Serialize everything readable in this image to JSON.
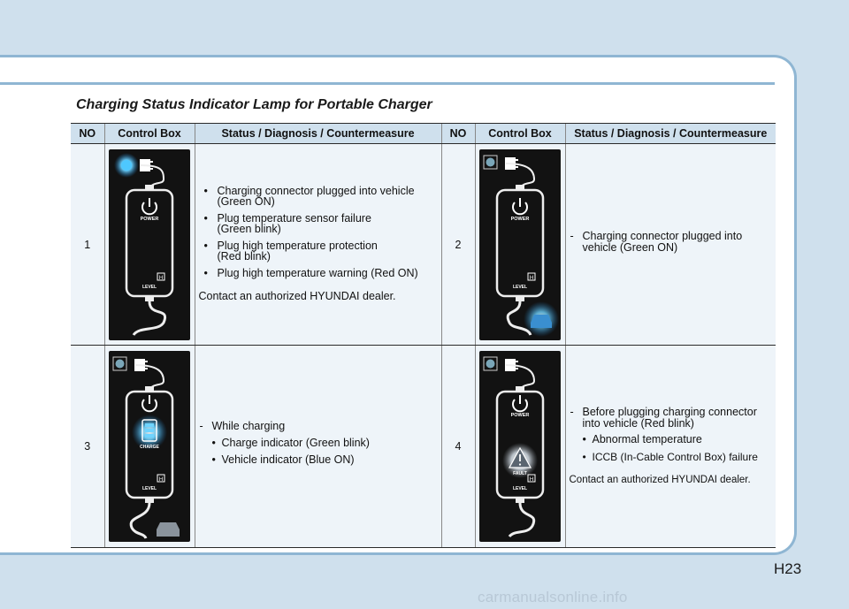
{
  "title": "Charging Status Indicator Lamp for Portable Charger",
  "table": {
    "headers": [
      "NO",
      "Control Box",
      "Status / Diagnosis / Countermeasure",
      "NO",
      "Control Box",
      "Status / Diagnosis / Countermeasure"
    ],
    "rows": [
      {
        "left": {
          "no": "1",
          "lines": [
            [
              "Charging connector plugged into vehicle",
              "(Green ON)"
            ],
            [
              "Plug temperature sensor failure",
              "(Green blink)"
            ],
            [
              "Plug high temperature protection",
              "(Red blink)"
            ],
            [
              "Plug high temperature warning (Red ON)"
            ]
          ],
          "contact": "Contact an authorized HYUNDAI dealer."
        },
        "right": {
          "no": "2",
          "dash": [
            "Charging connector plugged into",
            "vehicle (Green ON)"
          ]
        }
      },
      {
        "left": {
          "no": "3",
          "dash": "While charging",
          "sub": [
            "Charge indicator (Green blink)",
            "Vehicle indicator (Blue ON)"
          ]
        },
        "right": {
          "no": "4",
          "dash": [
            "Before plugging charging connector",
            "into vehicle (Red blink)"
          ],
          "sub": [
            "Abnormal temperature",
            "ICCB (In-Cable Control Box) failure"
          ],
          "contact": "Contact an authorized HYUNDAI dealer."
        }
      }
    ]
  },
  "device": {
    "power_label": "POWER",
    "level_label": "LEVEL",
    "level_badge": "H",
    "charge_label": "CHARGE",
    "fault_label": "FAULT"
  },
  "colors": {
    "background": "#cfe0ed",
    "accent": "#8fb6d3",
    "device": "#121212"
  },
  "page_number": "H23",
  "watermark": "carmanualsonline.info"
}
